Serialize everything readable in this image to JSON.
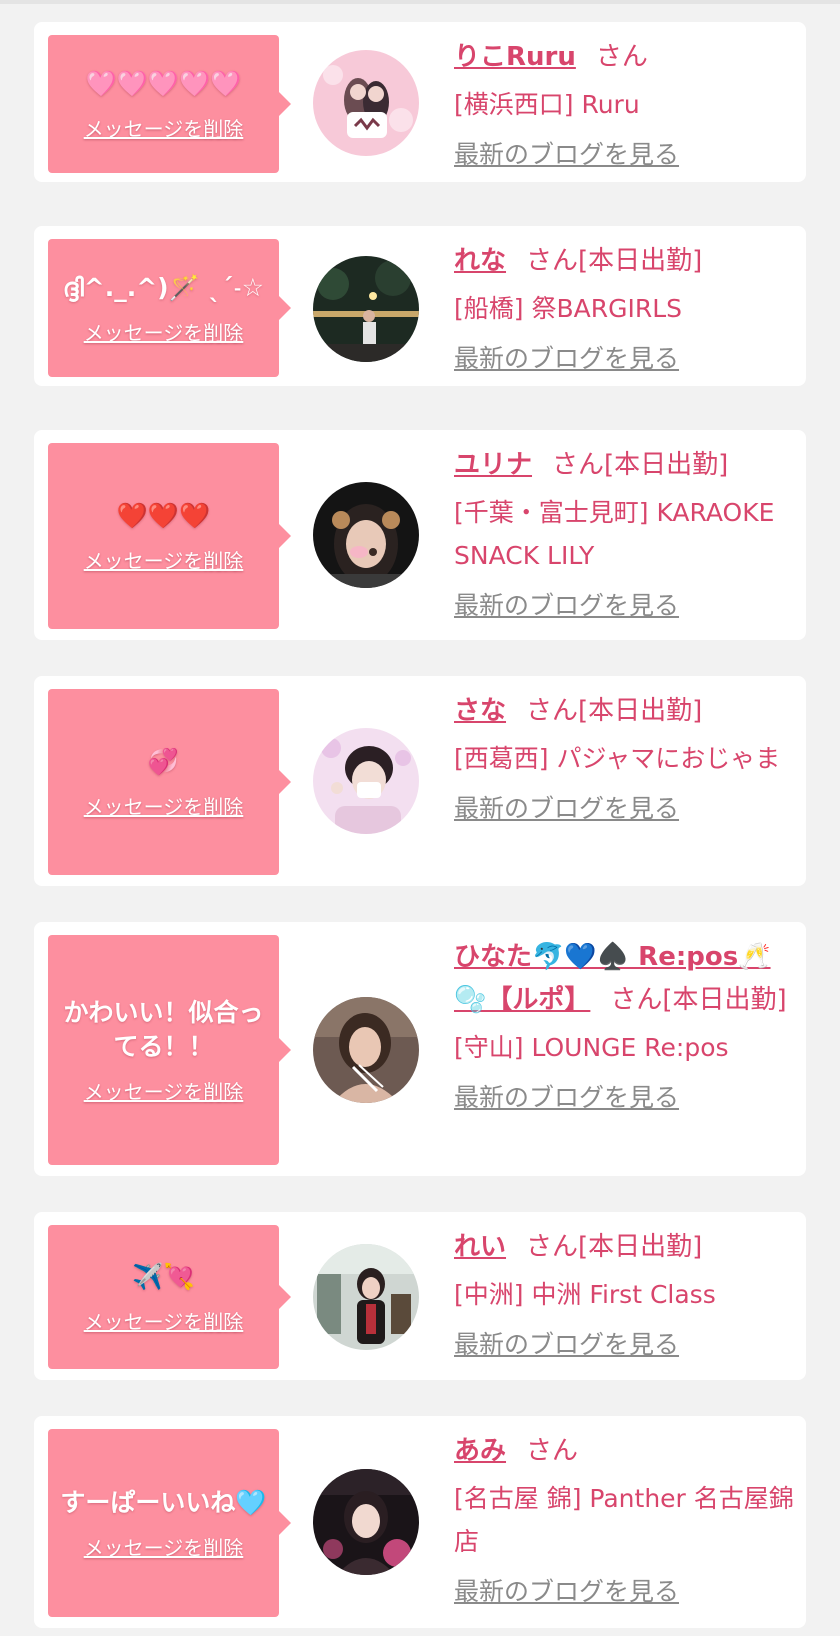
{
  "delete_label": "メッセージを削除",
  "san_label": "さん",
  "blog_label": "最新のブログを見る",
  "colors": {
    "page_bg": "#f2f2f2",
    "card_bg": "#ffffff",
    "bubble_bg": "#fd8f9f",
    "accent_text": "#d8456c",
    "link_gray": "#8a8a8a"
  },
  "entries": [
    {
      "message": "🩷🩷🩷🩷🩷",
      "name": "りこRuru",
      "status": "",
      "shop": "[横浜西口] Ruru",
      "avatar_icon": "girl-photo-pink-ruru"
    },
    {
      "message": "ദ്ദി^._.^)🪄 ˎˊ˗☆",
      "name": "れな",
      "status": "[本日出勤]",
      "shop": "[船橋] 祭BARGIRLS",
      "avatar_icon": "girl-photo-night"
    },
    {
      "message": "❤️❤️❤️",
      "name": "ユリナ",
      "status": "[本日出勤]",
      "shop": "[千葉・富士見町] KARAOKE SNACK LILY",
      "avatar_icon": "girl-photo-dark"
    },
    {
      "message": "💞",
      "name": "さな",
      "status": "[本日出勤]",
      "shop": "[西葛西] パジャマにおじゃま",
      "avatar_icon": "girl-photo-pajama"
    },
    {
      "message": "かわいい！似合ってる！！",
      "name": "ひなた🐬💙♠️ Re:pos🥂🫧【ルポ】",
      "status": "[本日出勤]",
      "shop": "[守山] LOUNGE Re:pos",
      "avatar_icon": "girl-photo-lounge"
    },
    {
      "message": "✈️💘",
      "name": "れい",
      "status": "[本日出勤]",
      "shop": "[中洲] 中洲 First Class",
      "avatar_icon": "girl-photo-bar"
    },
    {
      "message": "すーぱーいいね🩵",
      "name": "あみ",
      "status": "",
      "shop": "[名古屋 錦] Panther 名古屋錦店",
      "avatar_icon": "girl-photo-panther"
    }
  ]
}
